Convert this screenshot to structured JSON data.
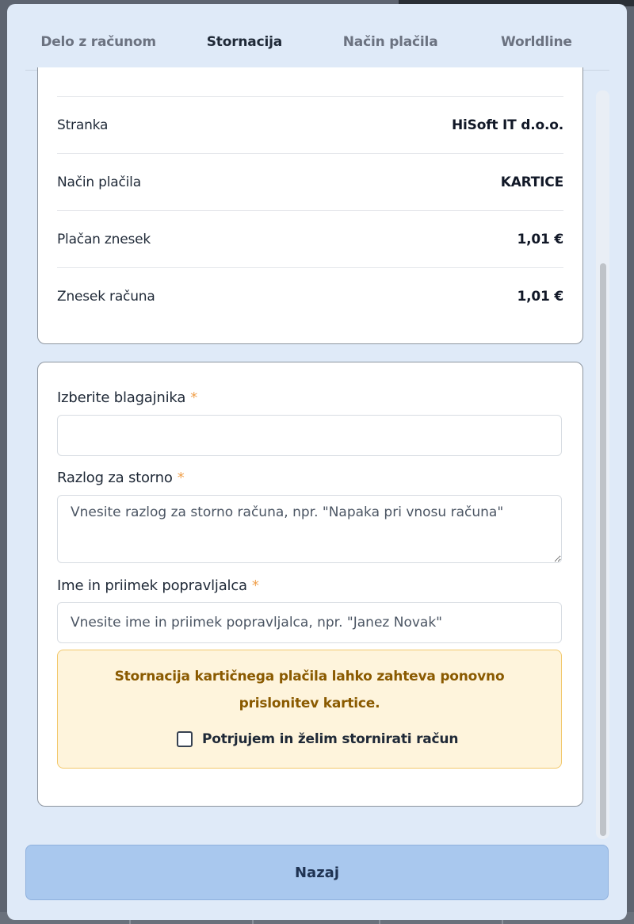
{
  "tabs": [
    {
      "label": "Delo z računom",
      "active": false
    },
    {
      "label": "Stornacija",
      "active": true
    },
    {
      "label": "Način plačila",
      "active": false
    },
    {
      "label": "Worldline",
      "active": false
    }
  ],
  "summary": {
    "rows": [
      {
        "label": "Stranka",
        "value": "HiSoft IT d.o.o."
      },
      {
        "label": "Način plačila",
        "value": "KARTICE"
      },
      {
        "label": "Plačan znesek",
        "value": "1,01 €"
      },
      {
        "label": "Znesek računa",
        "value": "1,01 €"
      }
    ]
  },
  "form": {
    "required_mark": "*",
    "cashier": {
      "label": "Izberite blagajnika",
      "value": ""
    },
    "reason": {
      "label": "Razlog za storno",
      "placeholder": "Vnesite razlog za storno računa, npr. \"Napaka pri vnosu računa\""
    },
    "corrector": {
      "label": "Ime in priimek popravljalca",
      "placeholder": "Vnesite ime in priimek popravljalca, npr. \"Janez Novak\""
    }
  },
  "warning": {
    "text": "Stornacija kartičnega plačila lahko zahteva ponovno prislonitev kartice.",
    "confirm_label": "Potrjujem in želim stornirati račun",
    "checked": false
  },
  "footer": {
    "back_label": "Nazaj"
  },
  "colors": {
    "accent": "#f0a14e",
    "warning_text": "#8a5a00",
    "button_bg": "#a9c8ee"
  }
}
